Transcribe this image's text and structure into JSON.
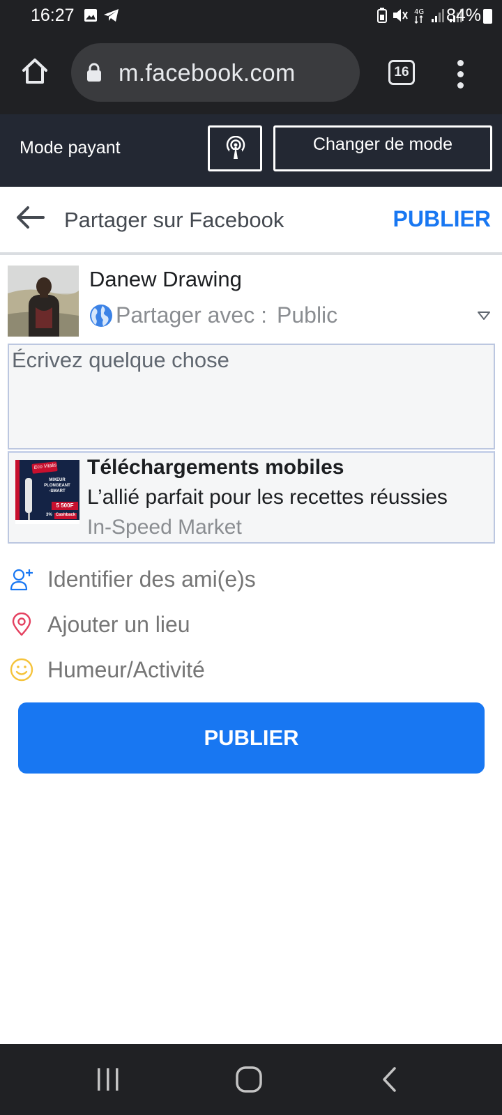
{
  "status_bar": {
    "time": "16:27",
    "network": "4G",
    "battery": "84%"
  },
  "browser": {
    "url": "m.facebook.com",
    "tab_count": "16"
  },
  "mode_banner": {
    "label": "Mode payant",
    "change_mode": "Changer de mode"
  },
  "header": {
    "title": "Partager sur Facebook",
    "publish": "PUBLIER"
  },
  "user": {
    "name": "Danew Drawing",
    "share_label": "Partager avec :",
    "share_value": "Public"
  },
  "composer": {
    "placeholder": "Écrivez quelque chose"
  },
  "link_preview": {
    "title": "Téléchargements mobiles",
    "description": "L’allié parfait pour les recettes réussies",
    "domain": "In-Speed Market",
    "thumb": {
      "brand": "Eco Vitalis",
      "product_line1": "MIXEUR",
      "product_line2": "PLONGEANT",
      "product_line3": "-SMART",
      "price": "5 500F",
      "cashback_pct": "3%",
      "cashback": "Cashback"
    }
  },
  "actions": [
    {
      "label": "Identifier des ami(e)s",
      "icon": "person-add-icon",
      "color": "#1877f2"
    },
    {
      "label": "Ajouter un lieu",
      "icon": "location-pin-icon",
      "color": "#e4405f"
    },
    {
      "label": "Humeur/Activité",
      "icon": "smiley-icon",
      "color": "#f5c33b"
    }
  ],
  "publish_button": "PUBLIER",
  "colors": {
    "brand_blue": "#1877f2",
    "dark_bar": "#202124",
    "banner": "#232833"
  }
}
